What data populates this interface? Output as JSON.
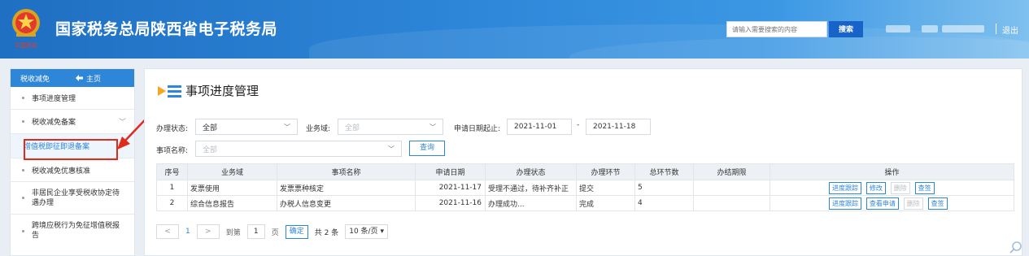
{
  "header": {
    "title": "国家税务总局陕西省电子税务局",
    "emblem_caption": "中国税务",
    "search_placeholder": "请输入需要搜索的内容",
    "search_button": "搜索",
    "logout": "退出",
    "colors": {
      "primary": "#2e86d8",
      "search_button": "#1863c7"
    }
  },
  "sidebar": {
    "section": "税收减免",
    "home": "主页",
    "items": [
      {
        "label": "事项进度管理"
      },
      {
        "label": "税收减免备案"
      },
      {
        "label": "增值税即征即退备案"
      },
      {
        "label": "税收减免优惠核准"
      },
      {
        "label": "非居民企业享受税收协定待遇办理"
      },
      {
        "label": "跨境应税行为免征增值税报告"
      }
    ],
    "active_index": 2,
    "highlight_color": "#e02a1c"
  },
  "main": {
    "page_title": "事项进度管理",
    "filters": {
      "status_label": "办理状态:",
      "status_value": "全部",
      "domain_label": "业务域:",
      "domain_placeholder": "全部",
      "date_label": "申请日期起止:",
      "date_from": "2021-11-01",
      "date_sep": "-",
      "date_to": "2021-11-18",
      "item_label": "事项名称:",
      "item_placeholder": "全部",
      "query_button": "查询"
    },
    "table": {
      "headers": [
        "序号",
        "业务域",
        "事项名称",
        "申请日期",
        "办理状态",
        "办理环节",
        "总环节数",
        "办结期限",
        "操作"
      ],
      "rows": [
        {
          "no": "1",
          "domain": "发票使用",
          "item": "发票票种核定",
          "date": "2021-11-17",
          "status": "受理不通过，待补齐补正",
          "stage": "提交",
          "total": "5",
          "deadline": "",
          "ops": [
            "进度跟踪",
            "修改",
            "删除",
            "查签"
          ]
        },
        {
          "no": "2",
          "domain": "综合信息报告",
          "item": "办税人信息变更",
          "date": "2021-11-16",
          "status": "办理成功...",
          "stage": "完成",
          "total": "4",
          "deadline": "",
          "ops": [
            "进度跟踪",
            "查看申请",
            "删除",
            "查签"
          ]
        }
      ]
    },
    "pagination": {
      "prev": "<",
      "current_page": "1",
      "next": ">",
      "goto_label": "到第",
      "goto_value": "1",
      "page_unit": "页",
      "confirm": "确定",
      "total_text": "共 2 条",
      "page_size": "10 条/页"
    }
  }
}
